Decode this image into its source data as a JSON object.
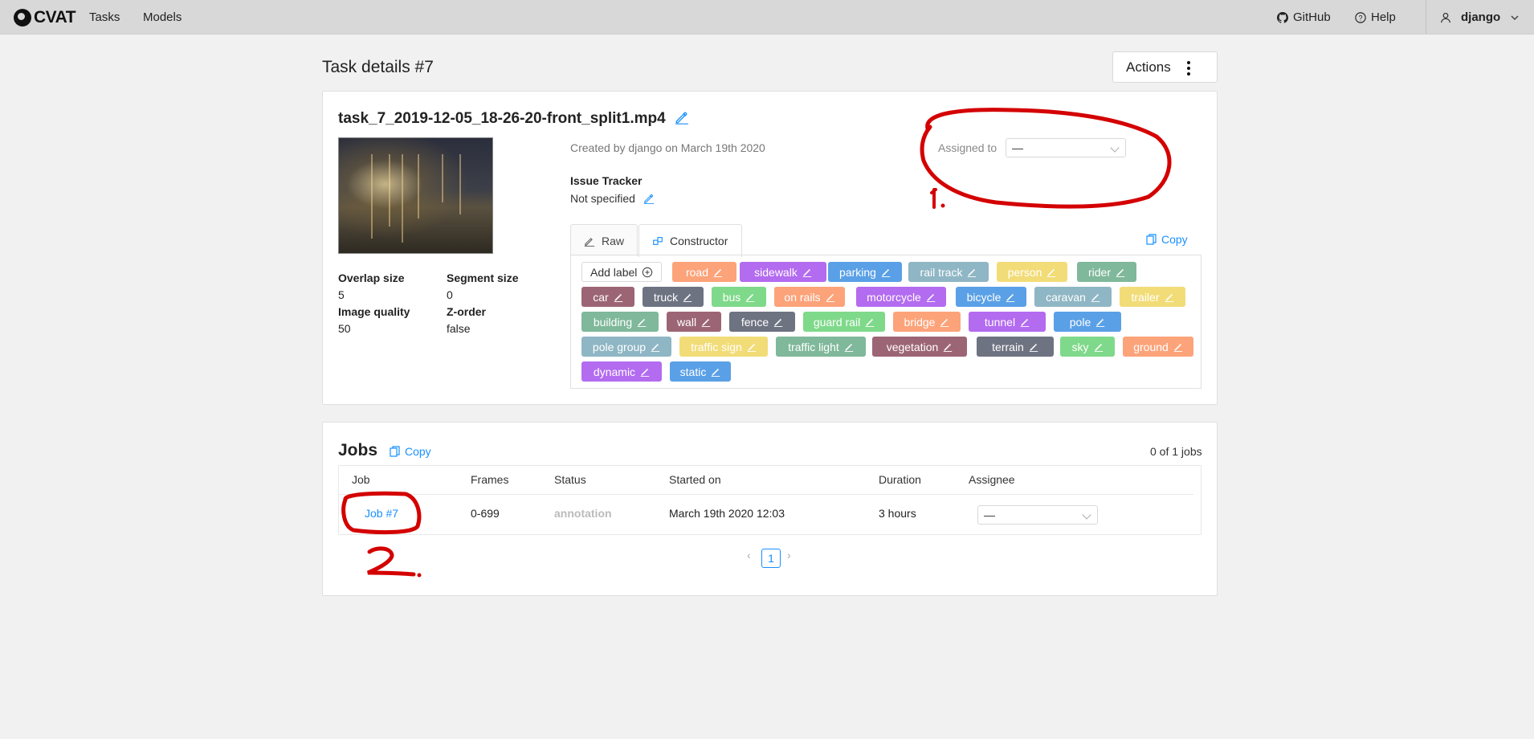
{
  "topbar": {
    "logo_text": "CVAT",
    "nav": [
      "Tasks",
      "Models"
    ],
    "github": "GitHub",
    "help": "Help",
    "user": "django"
  },
  "page": {
    "title": "Task details #7",
    "actions_label": "Actions"
  },
  "task": {
    "name": "task_7_2019-12-05_18-26-20-front_split1.mp4",
    "created": "Created by django on March 19th 2020",
    "issue_tracker_title": "Issue Tracker",
    "issue_tracker_value": "Not specified",
    "assigned_label": "Assigned to",
    "assigned_value": "—",
    "overlap_label": "Overlap size",
    "overlap_value": "5",
    "segment_label": "Segment size",
    "segment_value": "0",
    "quality_label": "Image quality",
    "quality_value": "50",
    "zorder_label": "Z-order",
    "zorder_value": "false"
  },
  "labels_editor": {
    "tabs": [
      "Raw",
      "Constructor"
    ],
    "copy_label": "Copy",
    "add_label": "Add label",
    "labels": [
      {
        "name": "road",
        "color": "#fca37a"
      },
      {
        "name": "sidewalk",
        "color": "#b36bf0"
      },
      {
        "name": "parking",
        "color": "#5aa0e6"
      },
      {
        "name": "rail track",
        "color": "#8fb6c4"
      },
      {
        "name": "person",
        "color": "#f2dc78"
      },
      {
        "name": "rider",
        "color": "#7fb89a"
      },
      {
        "name": "car",
        "color": "#9c6575"
      },
      {
        "name": "truck",
        "color": "#6e7382"
      },
      {
        "name": "bus",
        "color": "#7fd98a"
      },
      {
        "name": "on rails",
        "color": "#fca37a"
      },
      {
        "name": "motorcycle",
        "color": "#b36bf0"
      },
      {
        "name": "bicycle",
        "color": "#5aa0e6"
      },
      {
        "name": "caravan",
        "color": "#8fb6c4"
      },
      {
        "name": "trailer",
        "color": "#f2dc78"
      },
      {
        "name": "building",
        "color": "#7fb89a"
      },
      {
        "name": "wall",
        "color": "#9c6575"
      },
      {
        "name": "fence",
        "color": "#6e7382"
      },
      {
        "name": "guard rail",
        "color": "#7fd98a"
      },
      {
        "name": "bridge",
        "color": "#fca37a"
      },
      {
        "name": "tunnel",
        "color": "#b36bf0"
      },
      {
        "name": "pole",
        "color": "#5aa0e6"
      },
      {
        "name": "pole group",
        "color": "#8fb6c4"
      },
      {
        "name": "traffic sign",
        "color": "#f2dc78"
      },
      {
        "name": "traffic light",
        "color": "#7fb89a"
      },
      {
        "name": "vegetation",
        "color": "#9c6575"
      },
      {
        "name": "terrain",
        "color": "#6e7382"
      },
      {
        "name": "sky",
        "color": "#7fd98a"
      },
      {
        "name": "ground",
        "color": "#fca37a"
      },
      {
        "name": "dynamic",
        "color": "#b36bf0"
      },
      {
        "name": "static",
        "color": "#5aa0e6"
      }
    ]
  },
  "jobs": {
    "title": "Jobs",
    "copy_label": "Copy",
    "count": "0 of 1 jobs",
    "columns": [
      "Job",
      "Frames",
      "Status",
      "Started on",
      "Duration",
      "Assignee"
    ],
    "rows": [
      {
        "job": "Job #7",
        "frames": "0-699",
        "status": "annotation",
        "started": "March 19th 2020 12:03",
        "duration": "3 hours",
        "assignee": "—"
      }
    ],
    "page": "1"
  },
  "annotations": {
    "color": "#d40000",
    "marks": [
      "1.",
      "2."
    ]
  }
}
